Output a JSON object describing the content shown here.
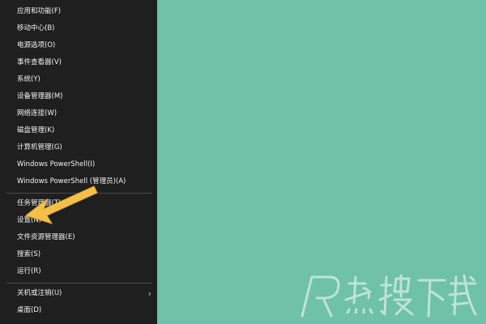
{
  "menu": {
    "items": [
      "应用和功能(F)",
      "移动中心(B)",
      "电源选项(O)",
      "事件查看器(V)",
      "系统(Y)",
      "设备管理器(M)",
      "网络连接(W)",
      "磁盘管理(K)",
      "计算机管理(G)",
      "Windows PowerShell(I)",
      "Windows PowerShell (管理员)(A)",
      "任务管理器(T)",
      "设置(N)",
      "文件资源管理器(E)",
      "搜索(S)",
      "运行(R)",
      "关机或注销(U)",
      "桌面(D)"
    ],
    "submenu_chevron": "›"
  },
  "desktop": {
    "background_color": "#6fc1a9"
  },
  "annotation": {
    "arrow_color": "#f5c04a",
    "icon": "pointer-arrow-icon"
  },
  "watermark": {
    "text": "R热搜下载",
    "icon": "watermark-logo"
  }
}
